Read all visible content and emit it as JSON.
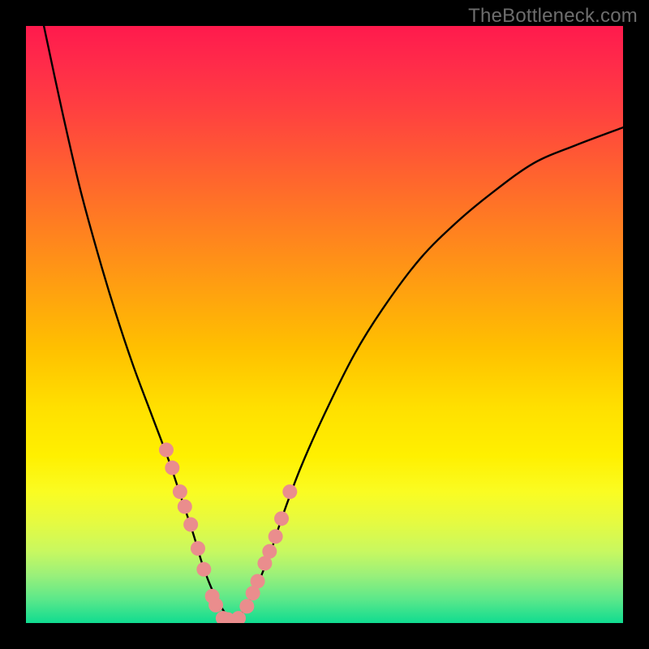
{
  "watermark": "TheBottleneck.com",
  "chart_data": {
    "type": "line",
    "title": "",
    "xlabel": "",
    "ylabel": "",
    "xlim": [
      0,
      100
    ],
    "ylim": [
      0,
      100
    ],
    "grid": false,
    "legend": false,
    "background": "rainbow-vertical-gradient",
    "series": [
      {
        "name": "bottleneck-curve",
        "color": "#000000",
        "x": [
          3,
          6,
          9,
          12,
          15,
          18,
          21,
          24,
          26,
          28,
          29.5,
          31,
          32.5,
          34,
          35.5,
          37,
          39,
          41,
          43,
          46,
          50,
          55,
          60,
          66,
          72,
          78,
          85,
          92,
          100
        ],
        "y": [
          100,
          86,
          73,
          62,
          52,
          43,
          35,
          27,
          21,
          15,
          10,
          6,
          3,
          1,
          1,
          3,
          7,
          12,
          18,
          26,
          35,
          45,
          53,
          61,
          67,
          72,
          77,
          80,
          83
        ]
      },
      {
        "name": "highlight-dots",
        "type": "scatter",
        "color": "#ea8d8d",
        "x": [
          23.5,
          24.5,
          25.8,
          26.6,
          27.6,
          28.8,
          29.8,
          31.2,
          31.8,
          33.0,
          33.8,
          35.6,
          37.0,
          38.0,
          38.8,
          40.0,
          40.8,
          41.8,
          42.8,
          44.2
        ],
        "y": [
          29.0,
          26.0,
          22.0,
          19.5,
          16.5,
          12.5,
          9.0,
          4.5,
          3.0,
          0.8,
          0.6,
          0.8,
          2.8,
          5.0,
          7.0,
          10.0,
          12.0,
          14.5,
          17.5,
          22.0
        ]
      }
    ]
  }
}
